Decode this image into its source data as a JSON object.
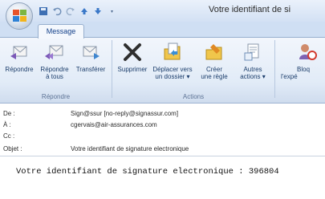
{
  "window": {
    "title": "Votre identifiant de si"
  },
  "tabs": [
    {
      "label": "Message"
    }
  ],
  "ribbon": {
    "groups": [
      {
        "label": "Répondre"
      },
      {
        "label": "Actions"
      }
    ],
    "buttons": {
      "reply": {
        "line1": "Répondre",
        "line2": ""
      },
      "reply_all": {
        "line1": "Répondre",
        "line2": "à tous"
      },
      "forward": {
        "line1": "Transférer",
        "line2": ""
      },
      "delete": {
        "line1": "Supprimer",
        "line2": ""
      },
      "move": {
        "line1": "Déplacer vers",
        "line2": "un dossier ▾"
      },
      "rule": {
        "line1": "Créer",
        "line2": "une règle"
      },
      "other": {
        "line1": "Autres",
        "line2": "actions ▾"
      },
      "block": {
        "line1": "Bloq",
        "line2": "l'expé"
      }
    }
  },
  "header": {
    "from_label": "De :",
    "from_value": "Sign@ssur [no-reply@signassur.com]",
    "to_label": "À :",
    "to_value": "cgervais@air-assurances.com",
    "cc_label": "Cc :",
    "cc_value": "",
    "subject_label": "Objet :",
    "subject_value": "Votre identifiant de signature electronique"
  },
  "body": {
    "text": "Votre identifiant de signature electronique : 396804"
  },
  "colors": {
    "accent": "#15428b",
    "ribbon_bg": "#dfe9f5"
  }
}
